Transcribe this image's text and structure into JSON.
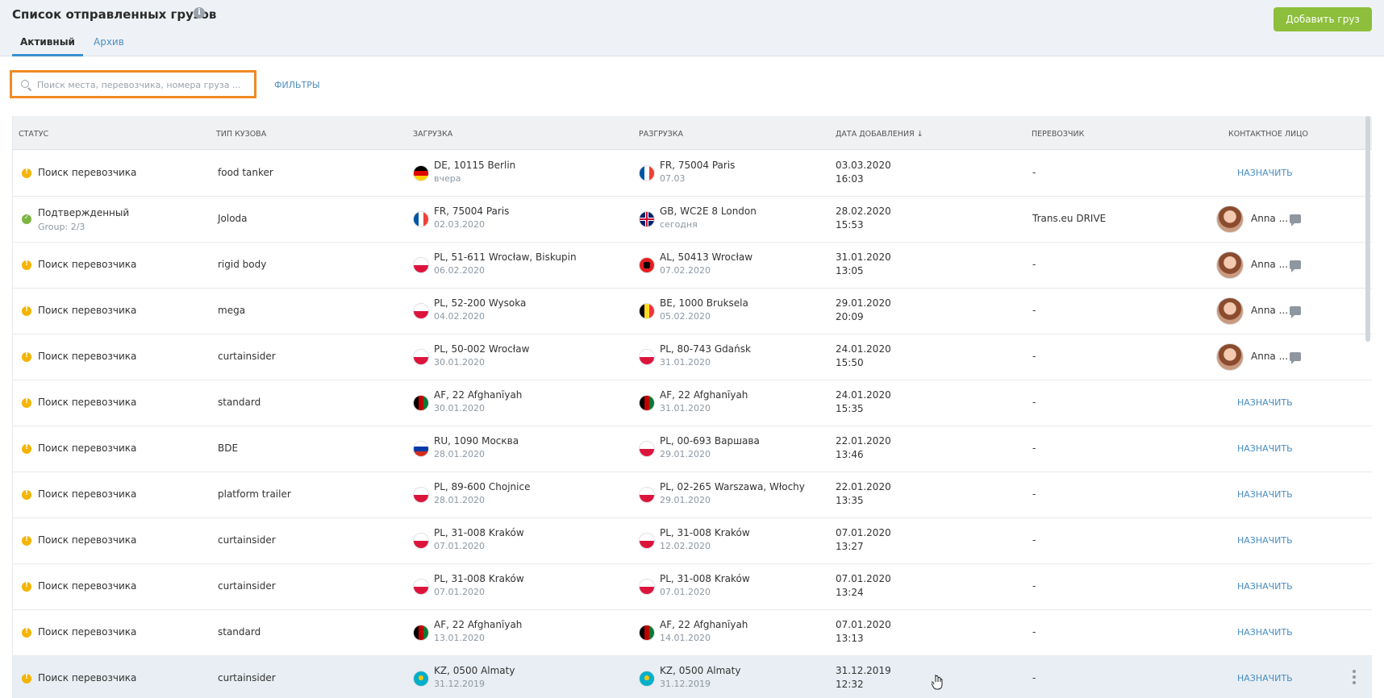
{
  "header": {
    "title": "Список отправленных грузов",
    "info_icon": "info-icon",
    "add_button": "Добавить груз",
    "tabs": [
      "Активный",
      "Архив"
    ]
  },
  "search": {
    "placeholder": "Поиск места, перевозчика, номера груза ...",
    "value": "",
    "filters_label": "ФИЛЬТРЫ"
  },
  "table": {
    "columns": [
      "СТАТУС",
      "ТИП КУЗОВА",
      "ЗАГРУЗКА",
      "РАЗГРУЗКА",
      "ДАТА ДОБАВЛЕНИЯ ↓",
      "ПЕРЕВОЗЧИК",
      "КОНТАКТНОЕ ЛИЦО"
    ],
    "assign_label": "НАЗНАЧИТЬ",
    "rows": [
      {
        "status": "Поиск перевозчика",
        "status_sub": "",
        "status_type": "warn",
        "body": "food tanker",
        "load_flag": "DE",
        "load": "DE, 10115 Berlin",
        "load_date": "вчера",
        "unload_flag": "FR",
        "unload": "FR, 75004 Paris",
        "unload_date": "07.03",
        "date": "03.03.2020",
        "time": "16:03",
        "carrier": "-",
        "contact": ""
      },
      {
        "status": "Подтвержденный",
        "status_sub": "Group: 2/3",
        "status_type": "ok",
        "body": "Joloda",
        "load_flag": "FR",
        "load": "FR, 75004 Paris",
        "load_date": "02.03.2020",
        "unload_flag": "GB",
        "unload": "GB, WC2E 8 London",
        "unload_date": "сегодня",
        "date": "28.02.2020",
        "time": "15:53",
        "carrier": "Trans.eu DRIVE",
        "contact": "Anna ..."
      },
      {
        "status": "Поиск перевозчика",
        "status_sub": "",
        "status_type": "warn",
        "body": "rigid body",
        "load_flag": "PL",
        "load": "PL, 51-611 Wrocław, Biskupin",
        "load_date": "06.02.2020",
        "unload_flag": "AL",
        "unload": "AL, 50413 Wrocław",
        "unload_date": "07.02.2020",
        "date": "31.01.2020",
        "time": "13:05",
        "carrier": "-",
        "contact": "Anna ..."
      },
      {
        "status": "Поиск перевозчика",
        "status_sub": "",
        "status_type": "warn",
        "body": "mega",
        "load_flag": "PL",
        "load": "PL, 52-200 Wysoka",
        "load_date": "04.02.2020",
        "unload_flag": "BE",
        "unload": "BE, 1000 Bruksela",
        "unload_date": "05.02.2020",
        "date": "29.01.2020",
        "time": "20:09",
        "carrier": "-",
        "contact": "Anna ..."
      },
      {
        "status": "Поиск перевозчика",
        "status_sub": "",
        "status_type": "warn",
        "body": "curtainsider",
        "load_flag": "PL",
        "load": "PL, 50-002 Wrocław",
        "load_date": "30.01.2020",
        "unload_flag": "PL",
        "unload": "PL, 80-743 Gdańsk",
        "unload_date": "31.01.2020",
        "date": "24.01.2020",
        "time": "15:50",
        "carrier": "-",
        "contact": "Anna ..."
      },
      {
        "status": "Поиск перевозчика",
        "status_sub": "",
        "status_type": "warn",
        "body": "standard",
        "load_flag": "AF",
        "load": "AF, 22 Afghanīyah",
        "load_date": "30.01.2020",
        "unload_flag": "AF",
        "unload": "AF, 22 Afghanīyah",
        "unload_date": "31.01.2020",
        "date": "24.01.2020",
        "time": "15:35",
        "carrier": "-",
        "contact": ""
      },
      {
        "status": "Поиск перевозчика",
        "status_sub": "",
        "status_type": "warn",
        "body": "BDE",
        "load_flag": "RU",
        "load": "RU, 1090 Москва",
        "load_date": "28.01.2020",
        "unload_flag": "PL",
        "unload": "PL, 00-693 Варшава",
        "unload_date": "29.01.2020",
        "date": "22.01.2020",
        "time": "13:46",
        "carrier": "-",
        "contact": ""
      },
      {
        "status": "Поиск перевозчика",
        "status_sub": "",
        "status_type": "warn",
        "body": "platform trailer",
        "load_flag": "PL",
        "load": "PL, 89-600 Chojnice",
        "load_date": "28.01.2020",
        "unload_flag": "PL",
        "unload": "PL, 02-265 Warszawa, Włochy",
        "unload_date": "29.01.2020",
        "date": "22.01.2020",
        "time": "13:35",
        "carrier": "-",
        "contact": ""
      },
      {
        "status": "Поиск перевозчика",
        "status_sub": "",
        "status_type": "warn",
        "body": "curtainsider",
        "load_flag": "PL",
        "load": "PL, 31-008 Kraków",
        "load_date": "07.01.2020",
        "unload_flag": "PL",
        "unload": "PL, 31-008 Kraków",
        "unload_date": "12.02.2020",
        "date": "07.01.2020",
        "time": "13:27",
        "carrier": "-",
        "contact": ""
      },
      {
        "status": "Поиск перевозчика",
        "status_sub": "",
        "status_type": "warn",
        "body": "curtainsider",
        "load_flag": "PL",
        "load": "PL, 31-008 Kraków",
        "load_date": "07.01.2020",
        "unload_flag": "PL",
        "unload": "PL, 31-008 Kraków",
        "unload_date": "07.01.2020",
        "date": "07.01.2020",
        "time": "13:24",
        "carrier": "-",
        "contact": ""
      },
      {
        "status": "Поиск перевозчика",
        "status_sub": "",
        "status_type": "warn",
        "body": "standard",
        "load_flag": "AF",
        "load": "AF, 22 Afghanīyah",
        "load_date": "13.01.2020",
        "unload_flag": "AF",
        "unload": "AF, 22 Afghanīyah",
        "unload_date": "14.01.2020",
        "date": "07.01.2020",
        "time": "13:13",
        "carrier": "-",
        "contact": ""
      },
      {
        "status": "Поиск перевозчика",
        "status_sub": "",
        "status_type": "warn",
        "body": "curtainsider",
        "load_flag": "KZ",
        "load": "KZ, 0500 Almaty",
        "load_date": "31.12.2019",
        "unload_flag": "KZ",
        "unload": "KZ, 0500 Almaty",
        "unload_date": "31.12.2019",
        "date": "31.12.2019",
        "time": "12:32",
        "carrier": "-",
        "contact": "",
        "hover": true
      }
    ]
  },
  "colors": {
    "accent": "#8dbe3c",
    "link": "#4a8ec3",
    "search_border": "#f08a24",
    "warning": "#f4b400",
    "success": "#7cb342"
  }
}
